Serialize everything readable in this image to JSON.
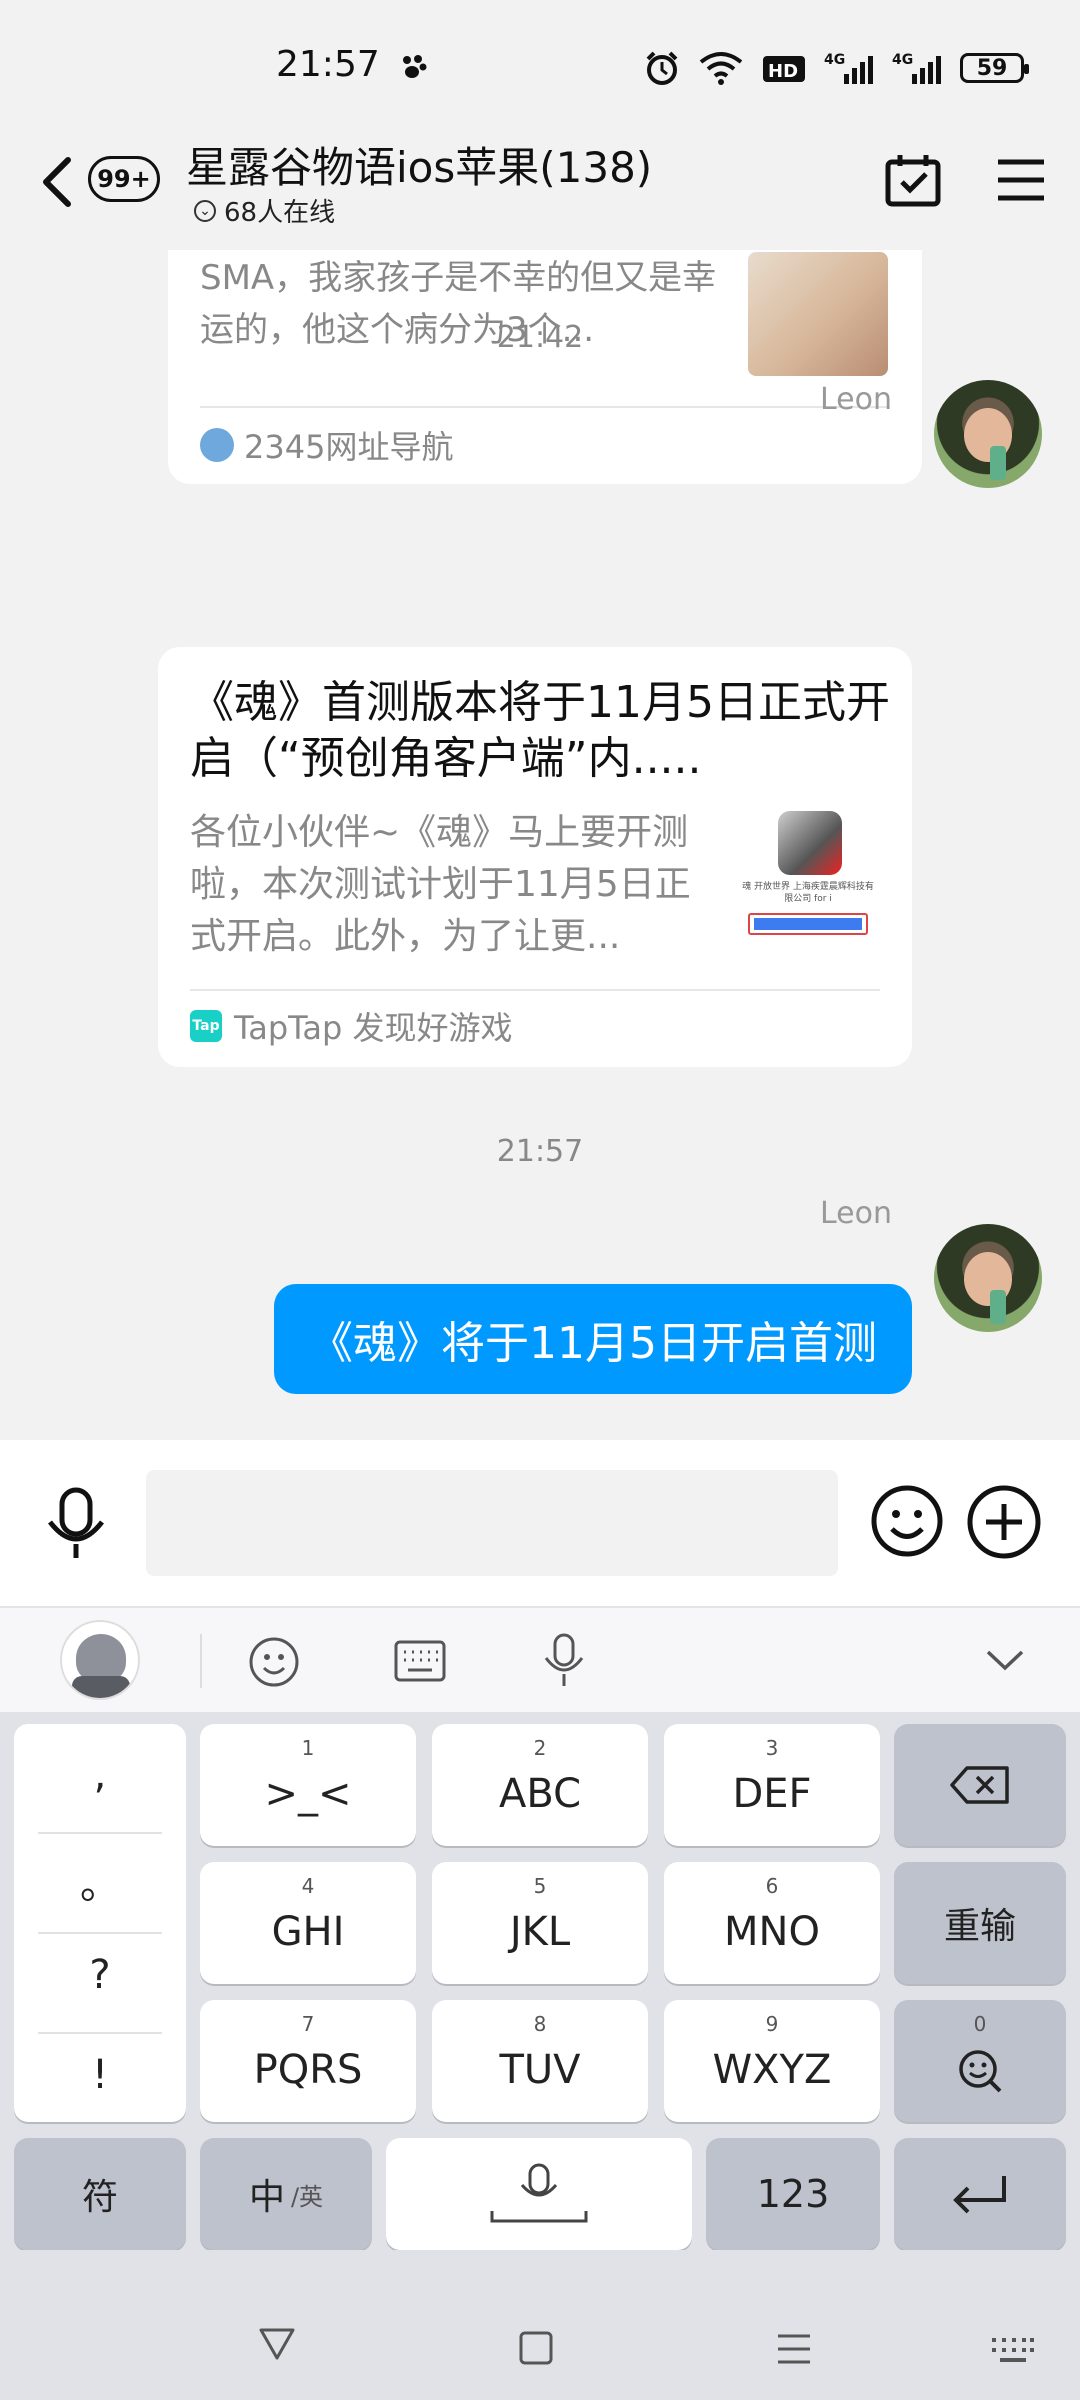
{
  "status_bar": {
    "time": "21:57",
    "battery": "59",
    "icons": [
      "paw-icon",
      "alarm-icon",
      "wifi-icon",
      "hd-icon",
      "signal-4g-icon",
      "signal-4g-icon",
      "battery-icon"
    ]
  },
  "header": {
    "unread_badge": "99+",
    "title": "星露谷物语ios苹果(138)",
    "online": "68人在线"
  },
  "messages": {
    "card1": {
      "desc": "SMA，我家孩子是不幸的但又是幸运的，他这个病分为3个...",
      "source": "2345网址导航"
    },
    "time1": "21:42",
    "sender1": "Leon",
    "card2": {
      "title": "《魂》首测版本将于11月5日正式开启（“预创角客户端”内.....",
      "desc": "各位小伙伴~《魂》马上要开测啦，本次测试计划于11月5日正式开启。此外，为了让更...",
      "thumb_text": "魂 开放世界 上海疾霆晨辉科技有限公司 for i",
      "source": "TapTap 发现好游戏",
      "source_logo": "Tap"
    },
    "time2": "21:57",
    "sender2": "Leon",
    "bubble": "《魂》将于11月5日开启首测"
  },
  "keyboard": {
    "punct": [
      ",",
      "。",
      "?",
      "!"
    ],
    "keys": [
      {
        "num": "1",
        "label": ">_<"
      },
      {
        "num": "2",
        "label": "ABC"
      },
      {
        "num": "3",
        "label": "DEF"
      },
      {
        "num": "4",
        "label": "GHI"
      },
      {
        "num": "5",
        "label": "JKL"
      },
      {
        "num": "6",
        "label": "MNO"
      },
      {
        "num": "7",
        "label": "PQRS"
      },
      {
        "num": "8",
        "label": "TUV"
      },
      {
        "num": "9",
        "label": "WXYZ"
      }
    ],
    "reinput": "重输",
    "zero": "0",
    "symbol": "符",
    "cn": "中",
    "en": "/英",
    "num123": "123"
  },
  "colors": {
    "accent": "#0099ff",
    "background": "#f2f2f2",
    "tap_logo": "#19d0c6"
  }
}
